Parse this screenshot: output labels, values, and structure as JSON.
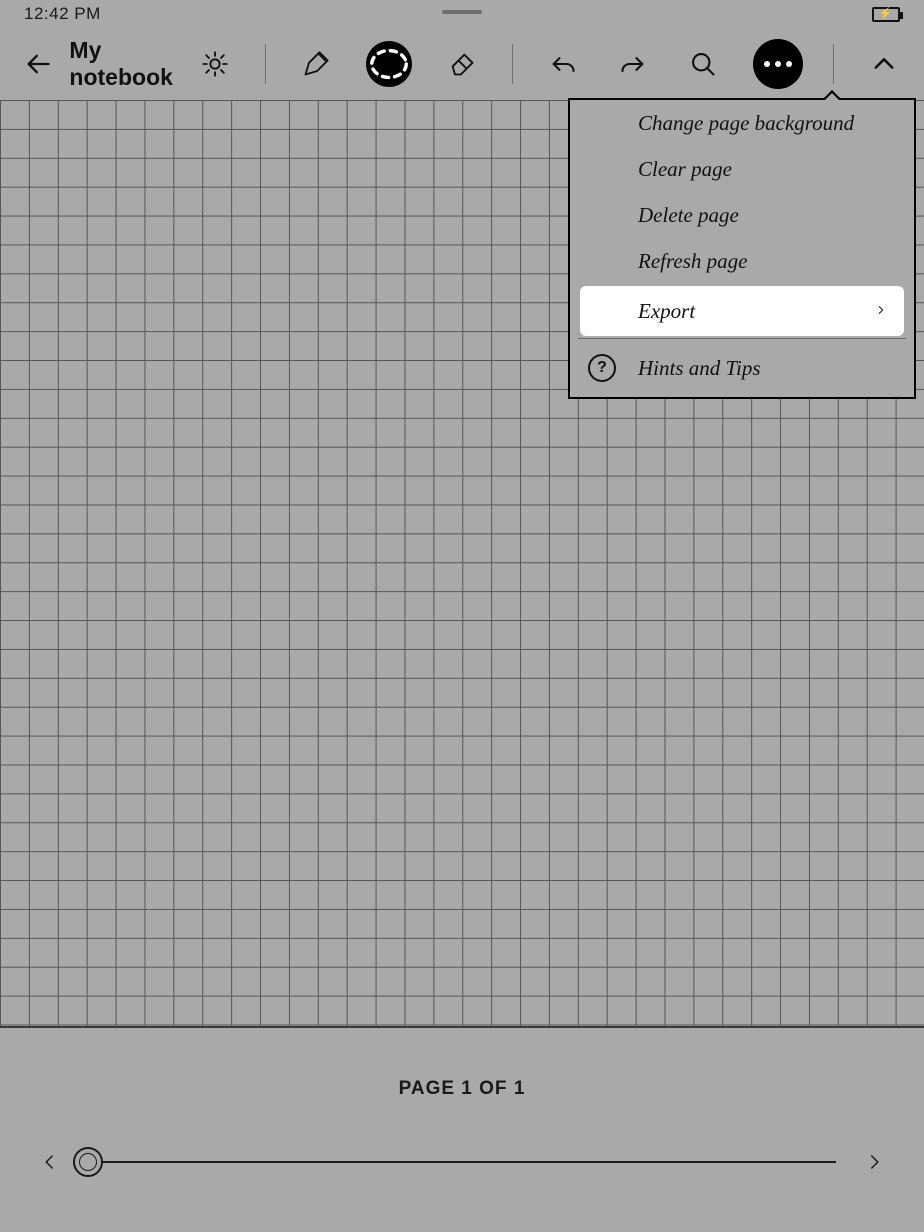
{
  "status": {
    "time": "12:42 PM"
  },
  "header": {
    "title": "My notebook"
  },
  "menu": {
    "items": [
      "Change page background",
      "Clear page",
      "Delete page",
      "Refresh page",
      "Export",
      "Hints and Tips"
    ],
    "help_glyph": "?"
  },
  "footer": {
    "page_label": "PAGE 1 OF 1"
  }
}
